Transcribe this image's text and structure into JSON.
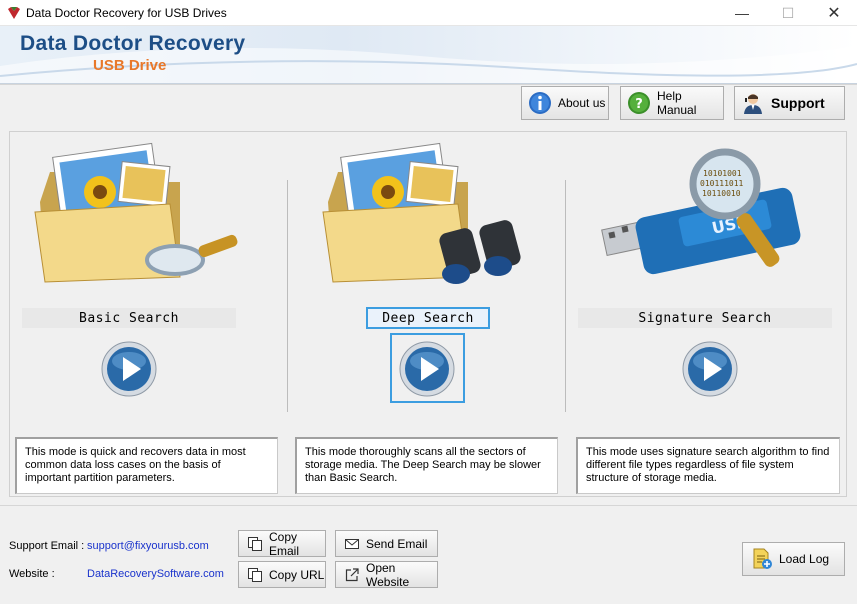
{
  "window": {
    "title": "Data Doctor Recovery for USB Drives",
    "minimize_glyph": "—",
    "maximize_glyph": "☐",
    "close_glyph": "✕"
  },
  "banner": {
    "title": "Data Doctor Recovery",
    "subtitle": "USB Drive",
    "title_color": "#1d4e86",
    "subtitle_color": "#e8782a"
  },
  "toolbar": {
    "about_label": "About us",
    "about_icon": "info-icon",
    "help_label": "Help Manual",
    "help_icon": "help-icon",
    "support_label": "Support",
    "support_icon": "support-person-icon"
  },
  "modes": {
    "basic": {
      "label": "Basic Search",
      "icon": "folder-magnifier-icon",
      "description": "This mode is quick and recovers data in most common data loss cases on the basis of important partition parameters."
    },
    "deep": {
      "label": "Deep Search",
      "icon": "folder-binoculars-icon",
      "selected": true,
      "description": "This mode thoroughly scans all the sectors of storage media. The Deep Search may be slower than Basic Search."
    },
    "signature": {
      "label": "Signature Search",
      "icon": "usb-drive-magnifier-icon",
      "description": "This mode uses signature search algorithm to find different file types regardless of file system structure of storage media."
    }
  },
  "footer": {
    "support_email_label": "Support Email :",
    "support_email": "support@fixyourusb.com",
    "website_label": "Website :",
    "website": "DataRecoverySoftware.com",
    "copy_email_label": "Copy Email",
    "copy_url_label": "Copy URL",
    "send_email_label": "Send Email",
    "open_website_label": "Open Website",
    "load_log_label": "Load Log"
  },
  "colors": {
    "accent": "#3c9de0",
    "link": "#1a33cc"
  }
}
